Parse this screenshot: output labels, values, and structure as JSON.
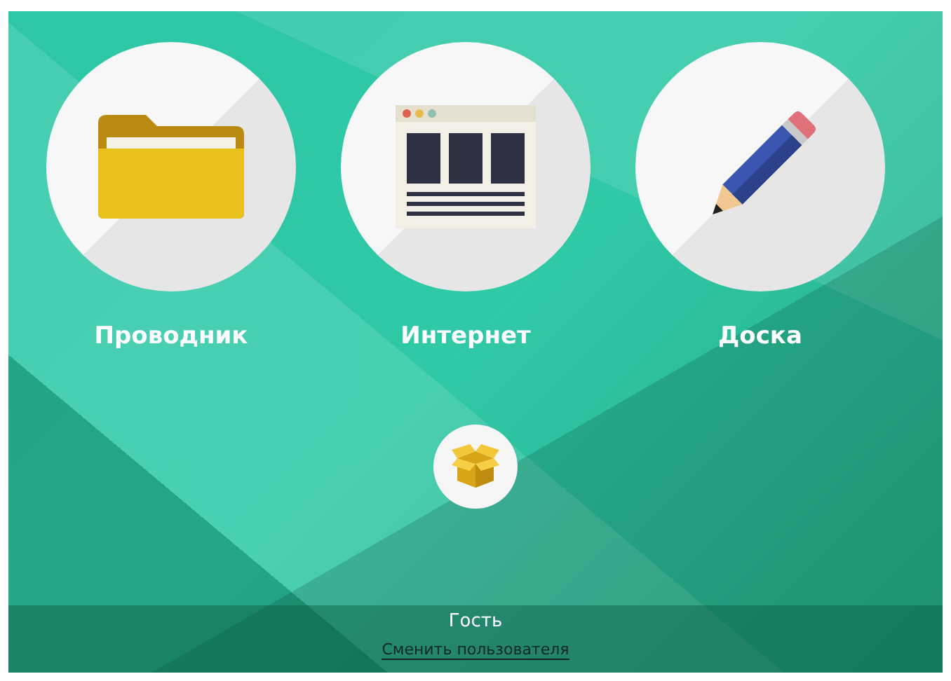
{
  "apps": [
    {
      "kind": "folder",
      "label": "Проводник"
    },
    {
      "kind": "browser",
      "label": "Интернет"
    },
    {
      "kind": "pencil",
      "label": "Доска"
    }
  ],
  "user": {
    "name": "Гость",
    "switch_link": "Сменить пользователя"
  }
}
